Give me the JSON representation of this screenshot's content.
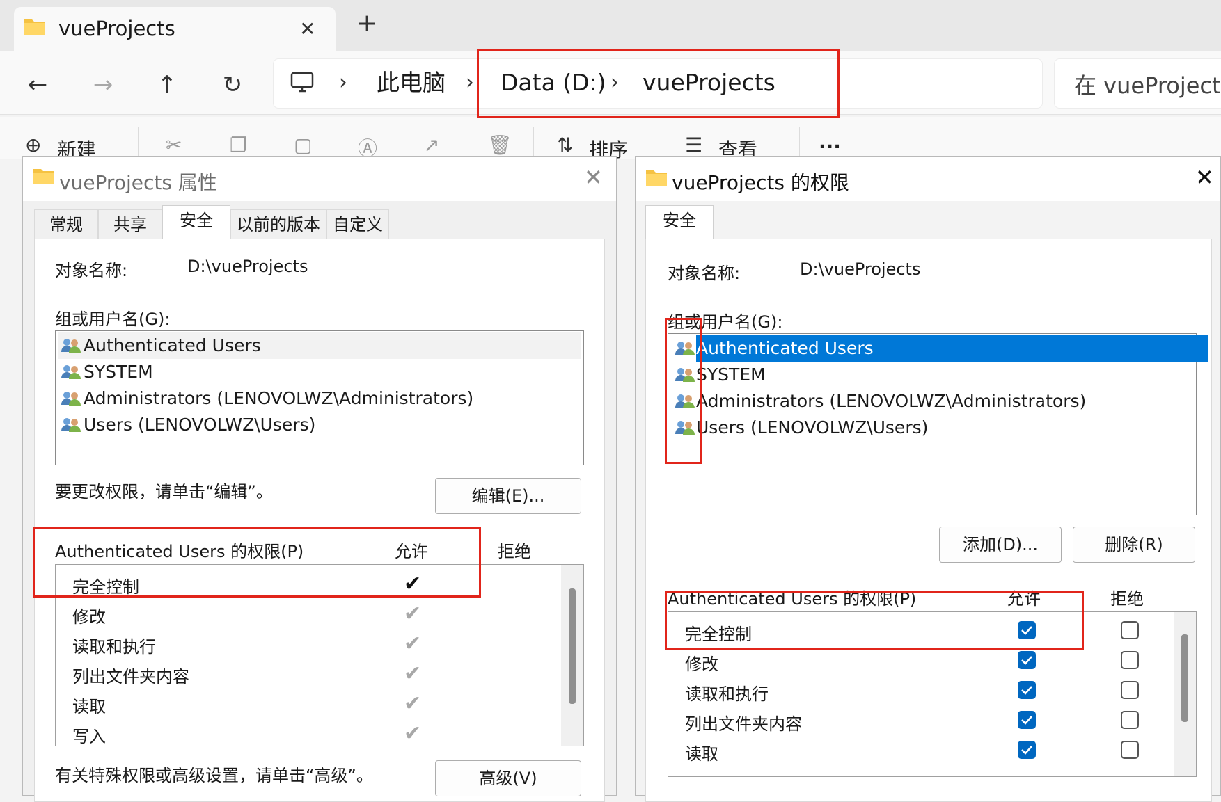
{
  "explorer": {
    "tab_title": "vueProjects",
    "tab_close": "✕",
    "new_tab": "+",
    "breadcrumb": [
      "此电脑",
      "Data (D:)",
      "vueProjects"
    ],
    "search_placeholder": "在 vueProjects",
    "toolbar": {
      "new": "新建",
      "sort": "排序",
      "view": "查看",
      "more": "···"
    }
  },
  "properties": {
    "title": "vueProjects 属性",
    "tabs": [
      "常规",
      "共享",
      "安全",
      "以前的版本",
      "自定义"
    ],
    "active_tab": "安全",
    "object_name_label": "对象名称:",
    "object_name_value": "D:\\vueProjects",
    "group_label": "组或用户名(G):",
    "users": [
      "Authenticated Users",
      "SYSTEM",
      "Administrators (LENOVOLWZ\\Administrators)",
      "Users (LENOVOLWZ\\Users)"
    ],
    "change_hint": "要更改权限，请单击“编辑”。",
    "edit_button": "编辑(E)...",
    "perm_header": "Authenticated Users 的权限(P)",
    "allow_header": "允许",
    "deny_header": "拒绝",
    "permissions": [
      "完全控制",
      "修改",
      "读取和执行",
      "列出文件夹内容",
      "读取",
      "写入"
    ],
    "advanced_hint": "有关特殊权限或高级设置，请单击“高级”。",
    "advanced_button": "高级(V)"
  },
  "permissions_dialog": {
    "title": "vueProjects 的权限",
    "tab": "安全",
    "object_name_label": "对象名称:",
    "object_name_value": "D:\\vueProjects",
    "group_label": "组或用户名(G):",
    "users": [
      "Authenticated Users",
      "SYSTEM",
      "Administrators (LENOVOLWZ\\Administrators)",
      "Users (LENOVOLWZ\\Users)"
    ],
    "selected_user": "Authenticated Users",
    "add_button": "添加(D)...",
    "remove_button": "删除(R)",
    "perm_header": "Authenticated Users 的权限(P)",
    "allow_header": "允许",
    "deny_header": "拒绝",
    "permissions": [
      "完全控制",
      "修改",
      "读取和执行",
      "列出文件夹内容",
      "读取"
    ]
  },
  "colors": {
    "highlight_red": "#e1251b",
    "selection_blue": "#0078d7",
    "checkbox_blue": "#0067c0"
  }
}
